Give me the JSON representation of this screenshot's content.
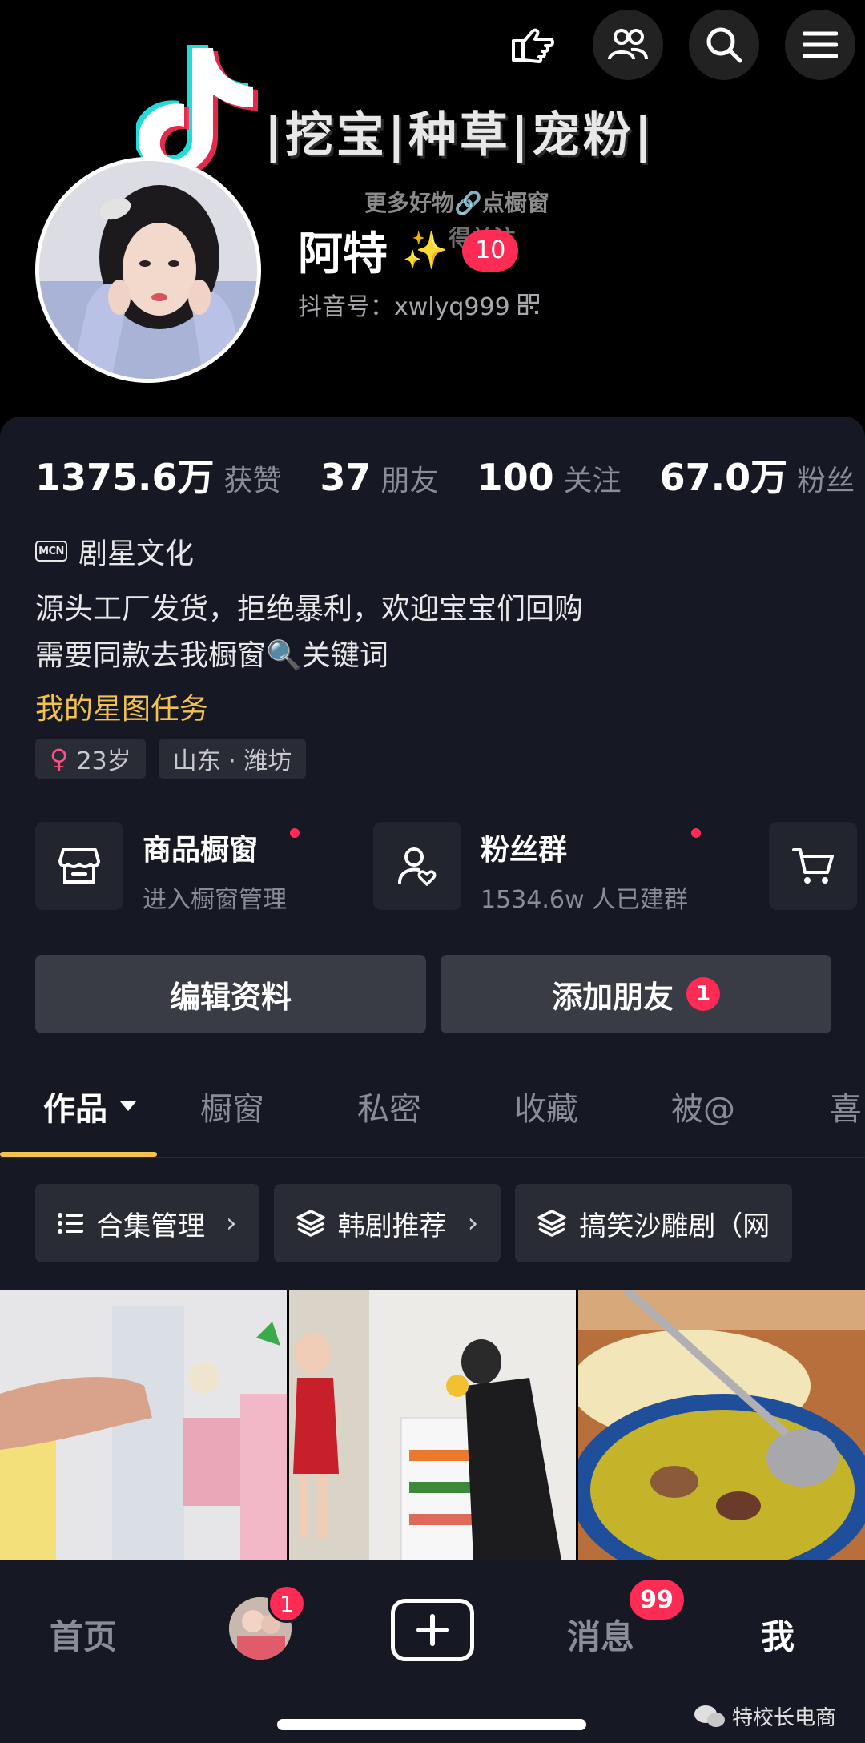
{
  "cover": {
    "banner": "|挖宝|种草|宠粉|",
    "sub_line1": "更多好物🔗点橱窗",
    "sub_line2": "得关注"
  },
  "top_icons": [
    "hand-point-icon",
    "friends-icon",
    "search-icon",
    "menu-icon"
  ],
  "profile": {
    "name": "阿特",
    "name_emoji": "✨",
    "name_badge": "10",
    "douyin_id": "抖音号：xwlyq999"
  },
  "stats": [
    {
      "num": "1375.6万",
      "label": "获赞"
    },
    {
      "num": "37",
      "label": "朋友"
    },
    {
      "num": "100",
      "label": "关注"
    },
    {
      "num": "67.0万",
      "label": "粉丝"
    }
  ],
  "mcn": {
    "icon_text": "MCN",
    "name": "剧星文化"
  },
  "bio": {
    "line1": "源头工厂发货，拒绝暴利，欢迎宝宝们回购",
    "line2": "需要同款去我橱窗🔍关键词"
  },
  "task_link": "我的星图任务",
  "tags": {
    "age": "23岁",
    "location": "山东 · 潍坊",
    "gender_symbol": "♀"
  },
  "services": [
    {
      "title": "商品橱窗",
      "sub": "进入橱窗管理"
    },
    {
      "title": "粉丝群",
      "sub": "1534.6w 人已建群"
    }
  ],
  "actions": {
    "edit": "编辑资料",
    "add_friend": "添加朋友",
    "add_friend_count": "1"
  },
  "tabs": [
    "作品",
    "橱窗",
    "私密",
    "收藏",
    "被@",
    "喜"
  ],
  "chips": [
    {
      "label": "合集管理",
      "icon": "list-icon"
    },
    {
      "label": "韩剧推荐",
      "icon": "layers-icon"
    },
    {
      "label": "搞笑沙雕剧（网",
      "icon": "layers-icon"
    }
  ],
  "bottom_nav": {
    "home": "首页",
    "friend_badge": "1",
    "messages": "消息",
    "messages_badge": "99",
    "me": "我"
  },
  "watermark": "特校长电商",
  "colors": {
    "accent_red": "#fe2c55",
    "gold": "#f2c14e",
    "panel_bg": "#161823",
    "muted_text": "#8b8d96"
  }
}
